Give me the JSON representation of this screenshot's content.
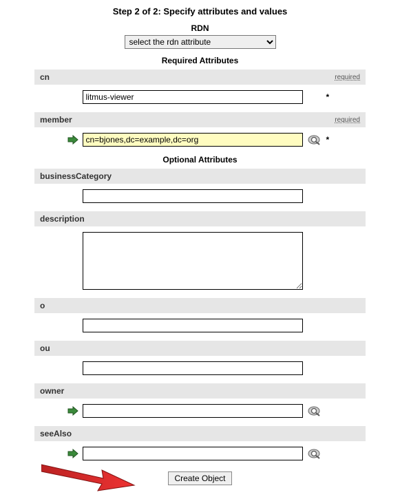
{
  "step_title": "Step 2 of 2: Specify attributes and values",
  "rdn": {
    "label": "RDN",
    "selected": "select the rdn attribute"
  },
  "sections": {
    "required": "Required Attributes",
    "optional": "Optional Attributes"
  },
  "required_tag": "required",
  "attrs": {
    "cn": {
      "label": "cn",
      "value": "litmus-viewer"
    },
    "member": {
      "label": "member",
      "value": "cn=bjones,dc=example,dc=org"
    },
    "businessCategory": {
      "label": "businessCategory",
      "value": ""
    },
    "description": {
      "label": "description",
      "value": ""
    },
    "o": {
      "label": "o",
      "value": ""
    },
    "ou": {
      "label": "ou",
      "value": ""
    },
    "owner": {
      "label": "owner",
      "value": ""
    },
    "seeAlso": {
      "label": "seeAlso",
      "value": ""
    }
  },
  "submit_label": "Create Object"
}
